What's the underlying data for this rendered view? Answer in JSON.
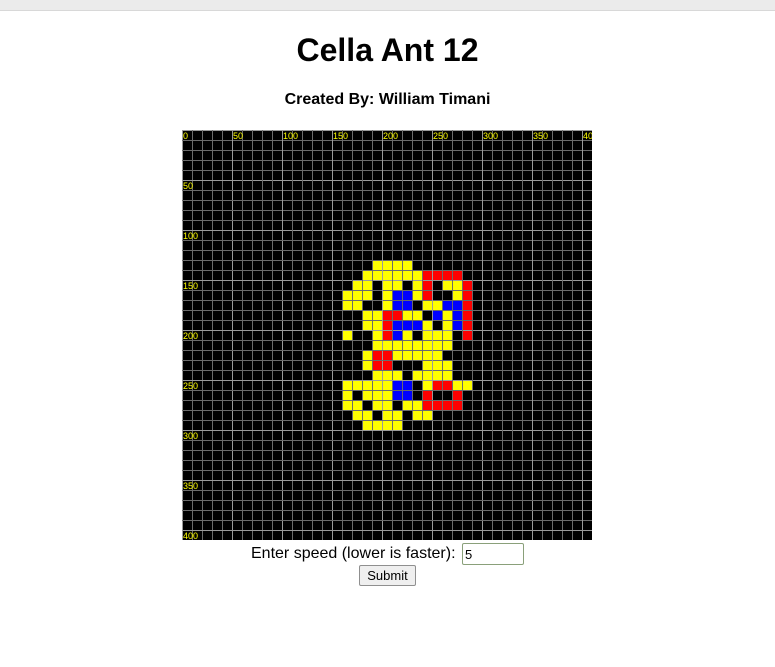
{
  "page": {
    "title": "Cella Ant 12",
    "author": "Created By: William Timani"
  },
  "grid": {
    "background_color": "#000000",
    "gridline_color": "#6b6b6b",
    "major_gridline_color": "#9a9a9a",
    "label_color": "#ffff00",
    "x_labels": [
      "0",
      "50",
      "100",
      "150",
      "200",
      "250",
      "300",
      "350",
      "400"
    ],
    "y_labels": [
      "50",
      "100",
      "150",
      "200",
      "250",
      "300",
      "350",
      "400"
    ],
    "cell_colors": {
      "Y": "#ffff00",
      "R": "#ff0000",
      "B": "#0000ff",
      "K": "#000000"
    },
    "pattern_origin_cell": [
      16,
      13
    ],
    "pattern": [
      "...YYYY.......",
      "..YYYYYYRRRR..",
      ".YYKYYKYRKYYR.",
      "YYYKYBBYRKKYR.",
      "YYKKYBBKYYBBR.",
      "KKYYRRYYKBYBR.",
      ".KYYRBBBYKYBR.",
      "YKKYRBYKYYYKR.",
      ".KKYYYYYYYYK..",
      "KKYRRYYYYYKK..",
      ".KYRRKKKYYYK..",
      ".KKYYYKYYYYK..",
      "YYYYYBBKYRRYY.",
      "YKYYYBBKRKKR..",
      "YYKYYKYYRRRR..",
      ".YYKYYKYY.....",
      "..YYYY........",
      "..............",
      ".............."
    ]
  },
  "controls": {
    "speed_label": "Enter speed (lower is faster):",
    "speed_value": "5",
    "submit_label": "Submit"
  }
}
